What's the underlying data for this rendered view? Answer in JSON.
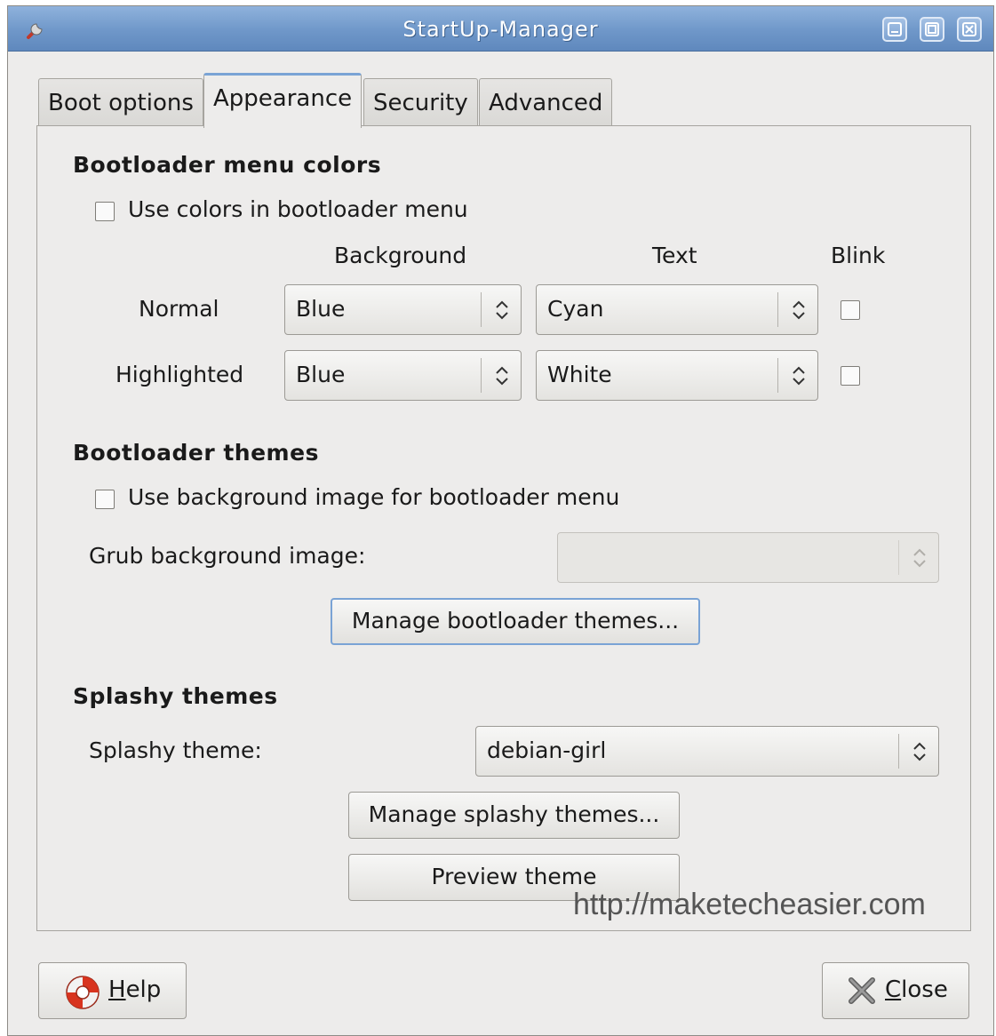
{
  "window": {
    "title": "StartUp-Manager"
  },
  "tabs": [
    {
      "label": "Boot options"
    },
    {
      "label": "Appearance"
    },
    {
      "label": "Security"
    },
    {
      "label": "Advanced"
    }
  ],
  "colors_section": {
    "heading": "Bootloader menu colors",
    "use_colors_label": "Use colors in bootloader menu",
    "col_background": "Background",
    "col_text": "Text",
    "col_blink": "Blink",
    "normal": {
      "label": "Normal",
      "background": "Blue",
      "text": "Cyan"
    },
    "highlighted": {
      "label": "Highlighted",
      "background": "Blue",
      "text": "White"
    }
  },
  "themes_section": {
    "heading": "Bootloader themes",
    "use_bg_label": "Use background image for bootloader menu",
    "grub_bg_label": "Grub background image:",
    "grub_bg_value": "",
    "manage_button": "Manage bootloader themes..."
  },
  "splashy_section": {
    "heading": "Splashy themes",
    "theme_label": "Splashy theme:",
    "theme_value": "debian-girl",
    "manage_button": "Manage splashy themes...",
    "preview_button": "Preview theme"
  },
  "watermark": "http://maketecheasier.com",
  "footer": {
    "help_mnemonic": "H",
    "help_rest": "elp",
    "close_mnemonic": "C",
    "close_rest": "lose"
  },
  "icons": {
    "title": "wrench-icon",
    "help": "lifebuoy-icon",
    "close": "x-icon"
  }
}
